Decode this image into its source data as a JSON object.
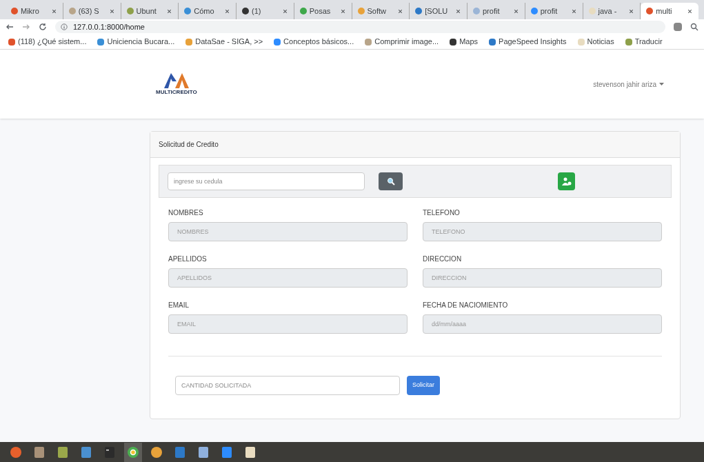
{
  "browser": {
    "tabs": [
      {
        "label": "Mikro",
        "selected": false
      },
      {
        "label": "(63) S",
        "selected": false
      },
      {
        "label": "Ubunt",
        "selected": false
      },
      {
        "label": "Cómo",
        "selected": false
      },
      {
        "label": "(1)",
        "selected": false
      },
      {
        "label": "Posas",
        "selected": false
      },
      {
        "label": "Softw",
        "selected": false
      },
      {
        "label": "[SOLU",
        "selected": false
      },
      {
        "label": "profit",
        "selected": false
      },
      {
        "label": "profit",
        "selected": false
      },
      {
        "label": "java -",
        "selected": false
      },
      {
        "label": "multi",
        "selected": true
      }
    ],
    "address": "127.0.0.1:8000/home",
    "bookmarks": [
      "(118) ¿Qué sistem...",
      "Uniciencia Bucara...",
      "DataSae - SIGA, >>",
      "Conceptos básicos...",
      "Comprimir image...",
      "Maps",
      "PageSpeed Insights",
      "Noticias",
      "Traducir"
    ]
  },
  "header": {
    "logo_text": "MULTICREDITO",
    "user": "stevenson jahir ariza"
  },
  "card": {
    "title": "Solicitud de Credito",
    "search": {
      "placeholder": "ingrese su cedula"
    },
    "fields": [
      {
        "label": "NOMBRES",
        "placeholder": "NOMBRES"
      },
      {
        "label": "TELEFONO",
        "placeholder": "TELEFONO"
      },
      {
        "label": "APELLIDOS",
        "placeholder": "APELLIDOS"
      },
      {
        "label": "DIRECCION",
        "placeholder": "DIRECCION"
      },
      {
        "label": "EMAIL",
        "placeholder": "EMAIL"
      },
      {
        "label": "FECHA DE NACIOMIENTO",
        "placeholder": "dd/mm/aaaa"
      }
    ],
    "amount": {
      "placeholder": "CANTIDAD SOLICITADA"
    },
    "submit": "Solicitar"
  },
  "taskbar": [
    {
      "kind": "firefox",
      "selected": false
    },
    {
      "kind": "files",
      "selected": false
    },
    {
      "kind": "device",
      "selected": false
    },
    {
      "kind": "document",
      "selected": false
    },
    {
      "kind": "terminal",
      "selected": false
    },
    {
      "kind": "chrome",
      "selected": true
    },
    {
      "kind": "photos",
      "selected": false
    },
    {
      "kind": "code",
      "selected": false
    },
    {
      "kind": "box",
      "selected": false
    },
    {
      "kind": "video",
      "selected": false
    },
    {
      "kind": "text",
      "selected": false
    }
  ]
}
